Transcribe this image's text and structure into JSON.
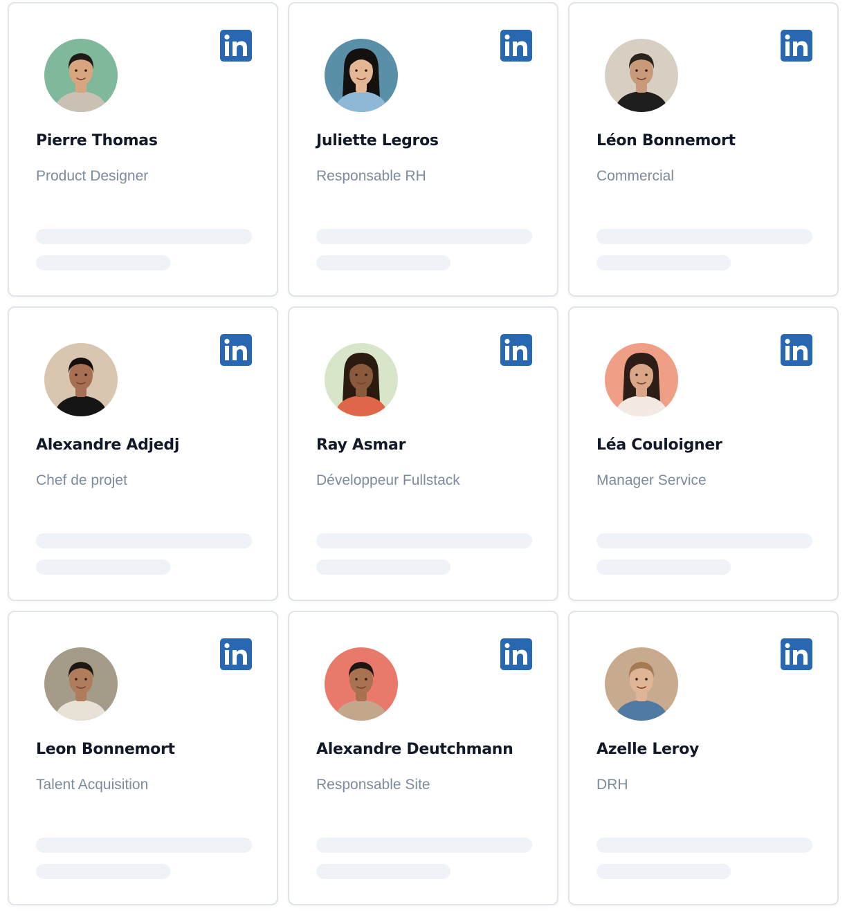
{
  "cards": [
    {
      "name": "Pierre Thomas",
      "role": "Product Designer",
      "avatar": {
        "bg": "#7fb89a",
        "skin": "#d9a57e",
        "hair": "#1f1a18",
        "shirt": "#c9c2b4",
        "long_hair": false
      },
      "social_icon": "linkedin-icon"
    },
    {
      "name": "Juliette Legros",
      "role": "Responsable RH",
      "avatar": {
        "bg": "#5a8fa8",
        "skin": "#e3b694",
        "hair": "#14100e",
        "shirt": "#8fb8d6",
        "long_hair": true
      },
      "social_icon": "linkedin-icon"
    },
    {
      "name": "Léon Bonnemort",
      "role": "Commercial",
      "avatar": {
        "bg": "#d8cfc3",
        "skin": "#c99a7a",
        "hair": "#2a221c",
        "shirt": "#1e1e1e",
        "long_hair": false
      },
      "social_icon": "linkedin-icon"
    },
    {
      "name": "Alexandre Adjedj",
      "role": "Chef de projet",
      "avatar": {
        "bg": "#d9c6b0",
        "skin": "#a87052",
        "hair": "#120f0d",
        "shirt": "#151515",
        "long_hair": false
      },
      "social_icon": "linkedin-icon"
    },
    {
      "name": "Ray Asmar",
      "role": "Développeur Fullstack",
      "avatar": {
        "bg": "#d7e6c9",
        "skin": "#8a5a3c",
        "hair": "#2b1a10",
        "shirt": "#e0664a",
        "long_hair": true
      },
      "social_icon": "linkedin-icon"
    },
    {
      "name": "Léa Couloigner",
      "role": "Manager Service",
      "avatar": {
        "bg": "#ee9f85",
        "skin": "#d9a688",
        "hair": "#2c1d16",
        "shirt": "#f3ebe3",
        "long_hair": true
      },
      "social_icon": "linkedin-icon"
    },
    {
      "name": "Leon Bonnemort",
      "role": "Talent Acquisition",
      "avatar": {
        "bg": "#a49c88",
        "skin": "#b07d5c",
        "hair": "#1d1712",
        "shirt": "#e8e1d6",
        "long_hair": false
      },
      "social_icon": "linkedin-icon"
    },
    {
      "name": "Alexandre Deutchmann",
      "role": "Responsable Site",
      "avatar": {
        "bg": "#e9796b",
        "skin": "#a8714f",
        "hair": "#1c1511",
        "shirt": "#c2a78a",
        "long_hair": false
      },
      "social_icon": "linkedin-icon"
    },
    {
      "name": "Azelle Leroy",
      "role": "DRH",
      "avatar": {
        "bg": "#c8ab8e",
        "skin": "#e0b596",
        "hair": "#a37a52",
        "shirt": "#4f7aa3",
        "long_hair": false
      },
      "social_icon": "linkedin-icon"
    }
  ],
  "colors": {
    "linkedin_blue": "#2867b2",
    "name_text": "#111827",
    "role_text": "#7b8b9d",
    "skeleton": "#eff2f6",
    "card_border": "#dfe4ea"
  }
}
